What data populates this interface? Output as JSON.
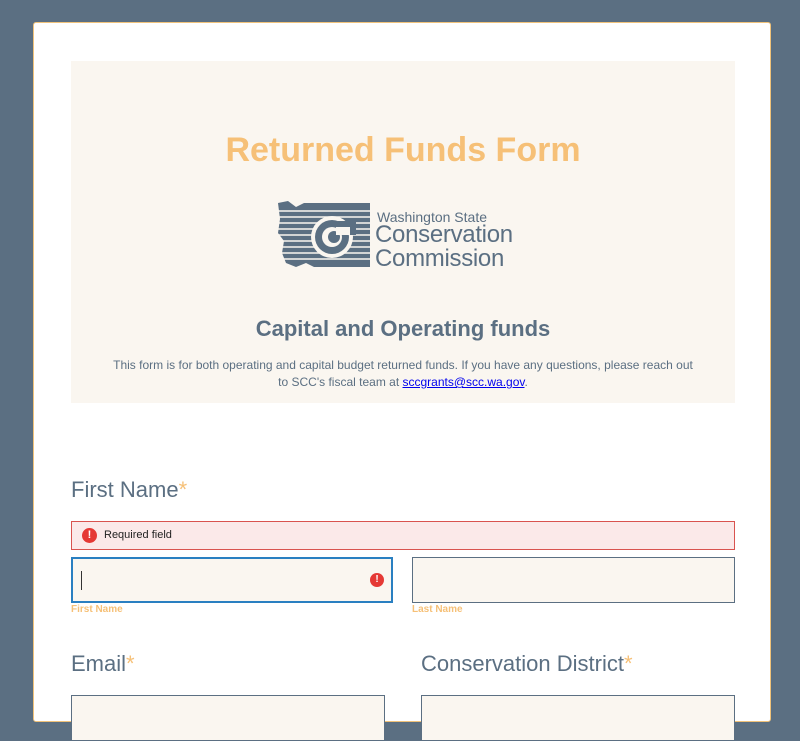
{
  "header": {
    "form_title": "Returned Funds Form",
    "logo": {
      "line1": "Washington State",
      "line2": "Conservation",
      "line3": "Commission"
    },
    "subtitle": "Capital and Operating funds",
    "description": "This form is for both operating and capital budget returned funds. If you have any questions, please reach out to SCC's fiscal team at ",
    "email_link": "sccgrants@scc.wa.gov",
    "description_end": "."
  },
  "fields": {
    "first_name": {
      "label": "First Name",
      "required_mark": "*",
      "error": "Required field",
      "first_value": "",
      "first_sublabel": "First Name",
      "last_value": "",
      "last_sublabel": "Last Name"
    },
    "email": {
      "label": "Email",
      "required_mark": "*",
      "value": ""
    },
    "conservation_district": {
      "label": "Conservation District",
      "required_mark": "*",
      "value": ""
    }
  },
  "colors": {
    "background": "#5b6f82",
    "accent": "#f6c077",
    "error": "#e53935",
    "focus": "#2a7fc1"
  },
  "icons": [
    "washington-state-logo",
    "error-icon"
  ]
}
